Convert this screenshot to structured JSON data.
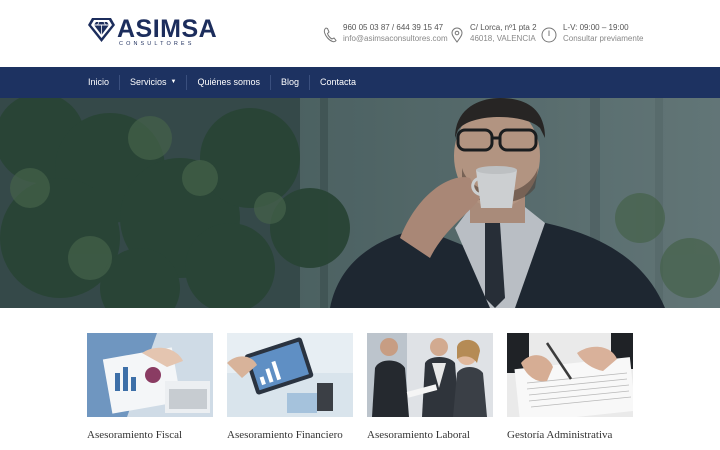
{
  "header": {
    "logo_name": "ASIMSA",
    "logo_sub": "CONSULTORES",
    "phone": {
      "icon": "phone-icon",
      "line1": "960 05 03 87 / 644 39 15 47",
      "line2": "info@asimsaconsultores.com"
    },
    "address": {
      "icon": "map-pin-icon",
      "line1": "C/ Lorca, nº1 pta 2",
      "line2": "46018, VALENCIA"
    },
    "hours": {
      "icon": "clock-icon",
      "line1": "L-V: 09:00 – 19:00",
      "line2": "Consultar previamente"
    }
  },
  "nav": {
    "items": [
      {
        "label": "Inicio"
      },
      {
        "label": "Servicios",
        "caret": "▼"
      },
      {
        "label": "Quiénes somos"
      },
      {
        "label": "Blog"
      },
      {
        "label": "Contacta"
      }
    ]
  },
  "colors": {
    "brand": "#1d3261",
    "logo": "#1c2d5c"
  },
  "cards": [
    {
      "title": "Asesoramiento Fiscal"
    },
    {
      "title": "Asesoramiento Financiero"
    },
    {
      "title": "Asesoramiento Laboral"
    },
    {
      "title": "Gestoría Administrativa"
    }
  ]
}
